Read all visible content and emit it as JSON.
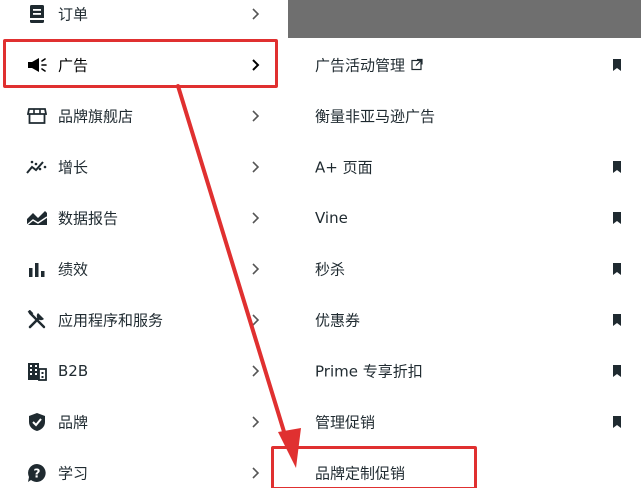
{
  "main_menu": {
    "items": [
      {
        "label": "订单",
        "icon": "order-icon"
      },
      {
        "label": "广告",
        "icon": "megaphone-icon"
      },
      {
        "label": "品牌旗舰店",
        "icon": "storefront-icon"
      },
      {
        "label": "增长",
        "icon": "growth-chart-icon"
      },
      {
        "label": "数据报告",
        "icon": "report-chart-icon"
      },
      {
        "label": "绩效",
        "icon": "bar-chart-icon"
      },
      {
        "label": "应用程序和服务",
        "icon": "tools-icon"
      },
      {
        "label": "B2B",
        "icon": "building-icon"
      },
      {
        "label": "品牌",
        "icon": "shield-check-icon"
      },
      {
        "label": "学习",
        "icon": "help-bubble-icon"
      }
    ],
    "active_item": "广告"
  },
  "ads_submenu": {
    "items": [
      {
        "label": "广告活动管理",
        "external": true,
        "bookmark": true
      },
      {
        "label": "衡量非亚马逊广告",
        "external": false,
        "bookmark": false
      },
      {
        "label": "A+ 页面",
        "external": false,
        "bookmark": true
      },
      {
        "label": "Vine",
        "external": false,
        "bookmark": true
      },
      {
        "label": "秒杀",
        "external": false,
        "bookmark": true
      },
      {
        "label": "优惠券",
        "external": false,
        "bookmark": true
      },
      {
        "label": "Prime 专享折扣",
        "external": false,
        "bookmark": true
      },
      {
        "label": "管理促销",
        "external": false,
        "bookmark": true
      },
      {
        "label": "品牌定制促销",
        "external": false,
        "bookmark": false
      }
    ],
    "highlighted_item": "品牌定制促销"
  },
  "colors": {
    "annotation_red": "#e03030",
    "backdrop": "#6f6f6f",
    "text": "#1f2a30"
  }
}
